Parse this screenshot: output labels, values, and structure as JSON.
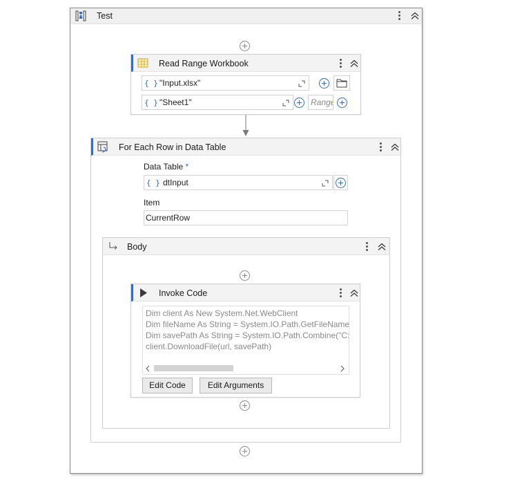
{
  "sequence": {
    "title": "Test"
  },
  "read_range": {
    "title": "Read Range Workbook",
    "workbook_path": "\"Input.xlsx\"",
    "sheet_name": "\"Sheet1\"",
    "range_placeholder": "Range",
    "expression_glyph": "{ }"
  },
  "for_each": {
    "title": "For Each Row in Data Table",
    "data_table_label": "Data Table",
    "required_mark": "*",
    "data_table_value": "dtInput",
    "item_label": "Item",
    "item_value": "CurrentRow"
  },
  "body": {
    "title": "Body"
  },
  "invoke_code": {
    "title": "Invoke Code",
    "code_lines": [
      "Dim client As New System.Net.WebClient",
      "Dim fileName As String = System.IO.Path.GetFileName(f",
      "Dim savePath As String = System.IO.Path.Combine(\"C:\\U",
      "client.DownloadFile(url, savePath)"
    ],
    "edit_code_label": "Edit Code",
    "edit_arguments_label": "Edit Arguments"
  },
  "colors": {
    "accent": "#2f6fc4",
    "header_bg": "#f0f0f0",
    "border": "#cfcfcf"
  }
}
